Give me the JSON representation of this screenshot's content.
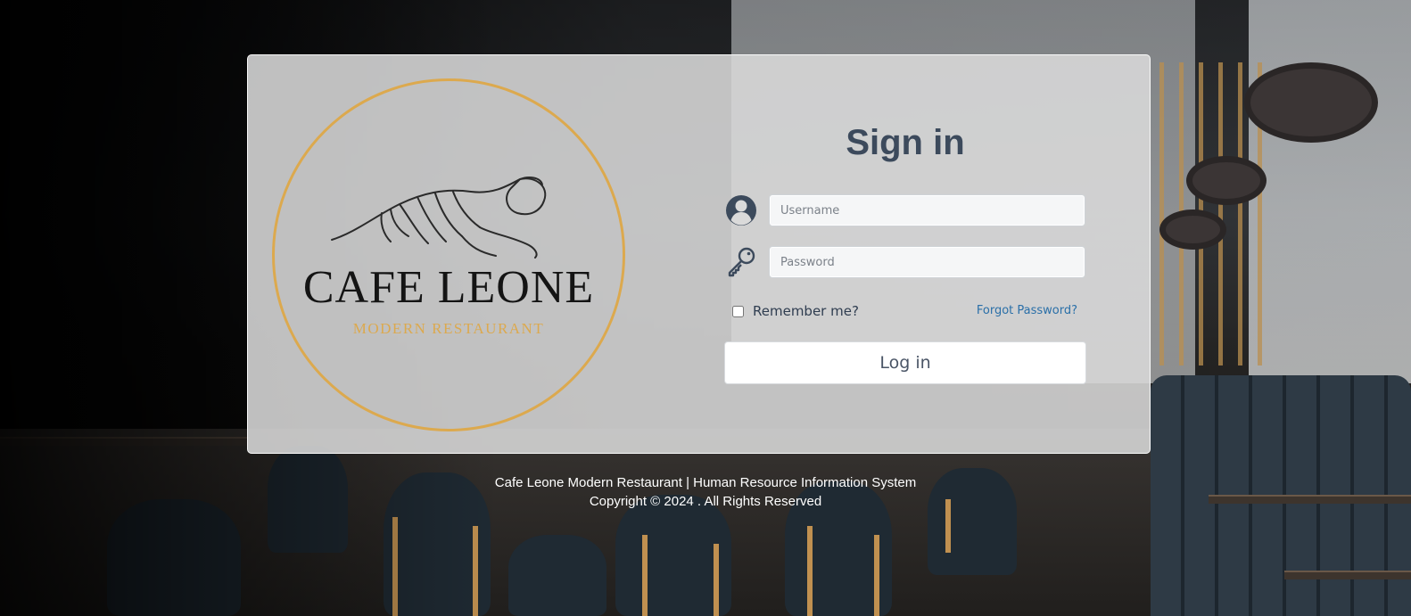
{
  "logo": {
    "name": "CAFE LEONE",
    "tagline": "MODERN RESTAURANT",
    "accent_color": "#dca94e"
  },
  "login": {
    "title": "Sign in",
    "username_placeholder": "Username",
    "password_placeholder": "Password",
    "username_icon": "user-circle-icon",
    "password_icon": "key-icon",
    "remember_label": "Remember me?",
    "forgot_label": "Forgot Password?",
    "submit_label": "Log in"
  },
  "footer": {
    "line1": "Cafe Leone Modern Restaurant | Human Resource Information System",
    "line2": "Copyright © 2024 . All Rights Reserved"
  },
  "colors": {
    "title": "#3c4a5c",
    "link": "#2a6fa8"
  }
}
